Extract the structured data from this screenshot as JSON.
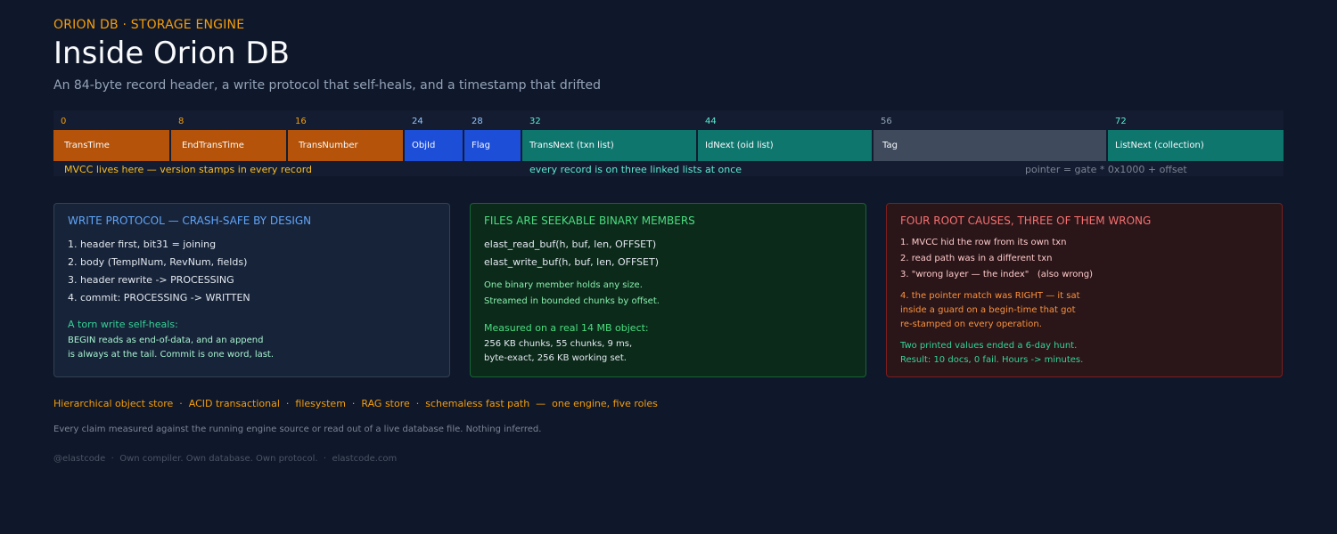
{
  "header": {
    "kicker": "ORION DB · STORAGE ENGINE",
    "title": "Inside Orion DB",
    "subtitle": "An 84-byte record header, a write protocol that self-heals, and a timestamp that drifted"
  },
  "record_header": {
    "offsets": [
      "0",
      "8",
      "16",
      "24",
      "28",
      "32",
      "44",
      "56",
      "72"
    ],
    "fields": [
      "TransTime",
      "EndTransTime",
      "TransNumber",
      "ObjId",
      "Flag",
      "TransNext (txn list)",
      "IdNext (oid list)",
      "Tag",
      "ListNext (collection)"
    ],
    "captions": {
      "mvcc": "MVCC lives here — version stamps in every record",
      "lists": "every record is on three linked lists at once",
      "pointer": "pointer = gate * 0x1000 + offset"
    },
    "colors": {
      "mvcc": "#b45309",
      "id": "#1d4ed8",
      "list": "#0f766e",
      "tag": "#3f4a5c"
    }
  },
  "cards": {
    "write": {
      "title": "WRITE PROTOCOL — CRASH-SAFE BY DESIGN",
      "lines": [
        "1. header first, bit31 = joining",
        "2. body (TemplNum, RevNum, fields)",
        "3. header rewrite -> PROCESSING",
        "4. commit: PROCESSING -> WRITTEN"
      ],
      "subhead": "A torn write self-heals:",
      "notes": [
        "BEGIN reads as end-of-data, and an append",
        "is always at the tail. Commit is one word, last."
      ]
    },
    "files": {
      "title": "FILES ARE SEEKABLE BINARY MEMBERS",
      "lines": [
        "elast_read_buf(h, buf, len, OFFSET)",
        "elast_write_buf(h, buf, len, OFFSET)"
      ],
      "notes": [
        "One binary member holds any size.",
        "Streamed in bounded chunks by offset."
      ],
      "subhead": "Measured on a real 14 MB object:",
      "measures": [
        "256 KB chunks, 55 chunks, 9 ms,",
        "byte-exact, 256 KB working set."
      ]
    },
    "causes": {
      "title": "FOUR ROOT CAUSES, THREE OF THEM WRONG",
      "wrong": [
        "1. MVCC hid the row from its own txn",
        "2. read path was in a different txn",
        "3. \"wrong layer — the index\"   (also wrong)"
      ],
      "right": [
        "4. the pointer match was RIGHT — it sat",
        "inside a guard on a begin-time that got",
        "re-stamped on every operation."
      ],
      "result": [
        "Two printed values ended a 6-day hunt.",
        "Result: 10 docs, 0 fail. Hours -> minutes."
      ]
    }
  },
  "roles": "Hierarchical object store  ·  ACID transactional  ·  filesystem  ·  RAG store  ·  schemaless fast path  —  one engine, five roles",
  "note": "Every claim measured against the running engine source or read out of a live database file. Nothing inferred.",
  "footer": "@elastcode  ·  Own compiler. Own database. Own protocol.  ·  elastcode.com"
}
